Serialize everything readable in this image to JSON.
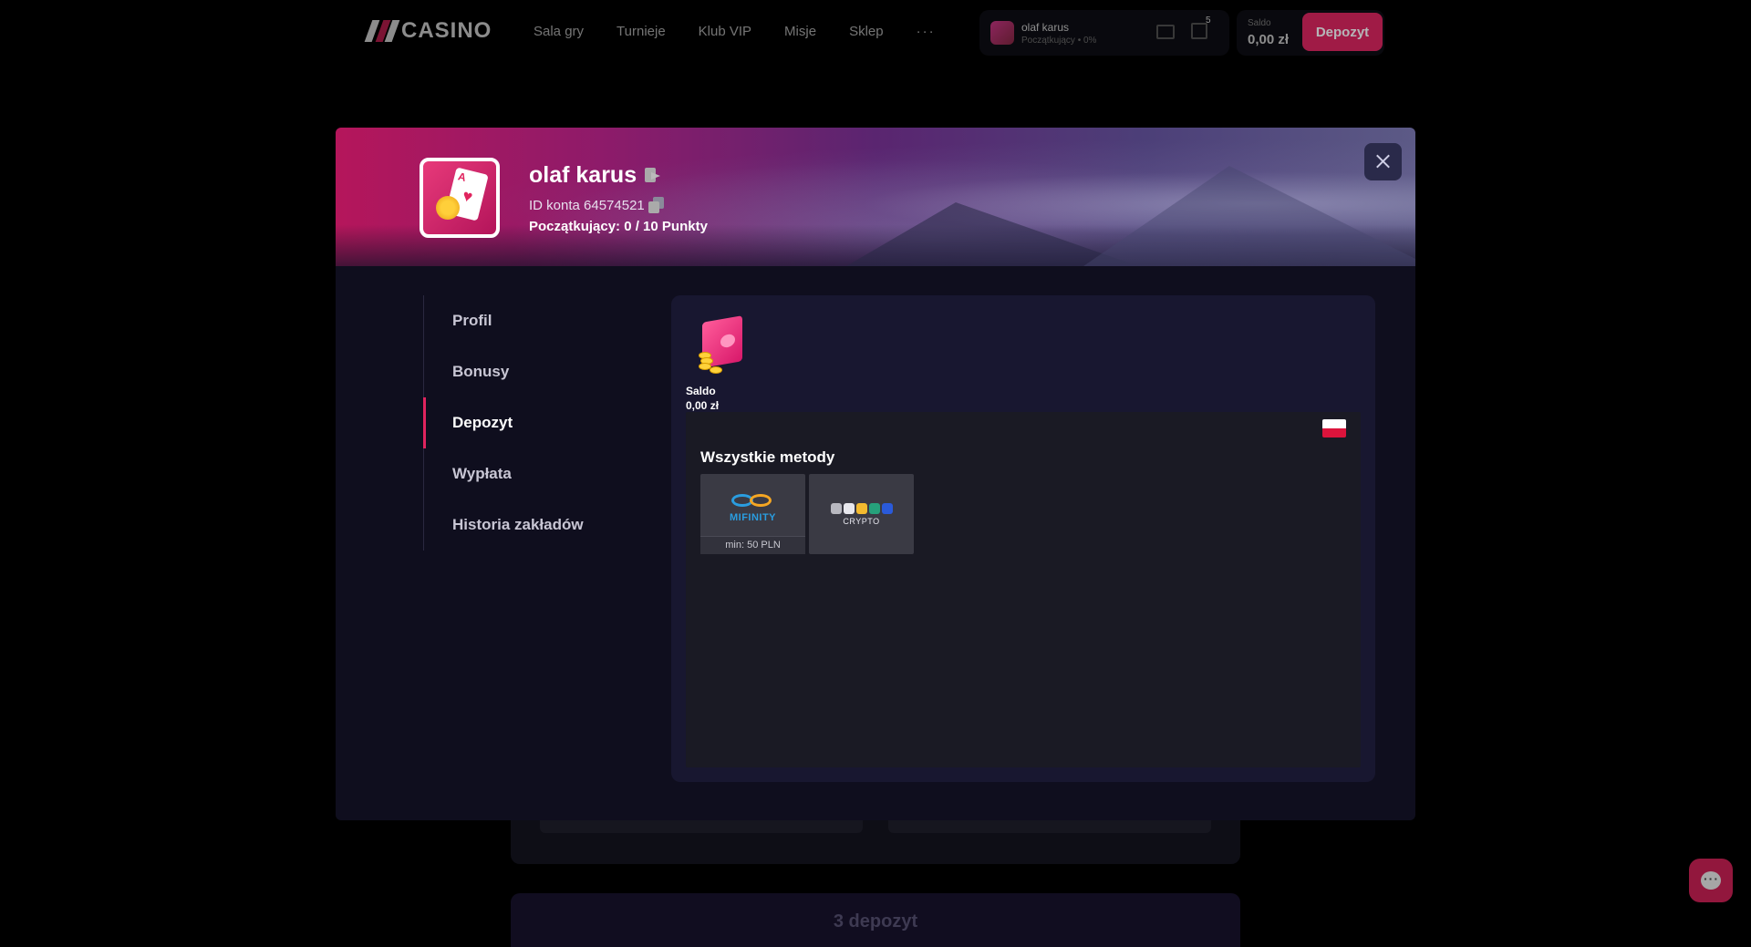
{
  "header": {
    "logo_text": "CASINO",
    "nav": [
      "Sala gry",
      "Turnieje",
      "Klub VIP",
      "Misje",
      "Sklep"
    ],
    "more": "···",
    "user_chip": {
      "name": "olaf karus",
      "level": "Początkujący • 0%",
      "gift_count": "5"
    },
    "balance": {
      "label": "Saldo",
      "value": "0,00 zł"
    },
    "deposit_button": "Depozyt"
  },
  "modal": {
    "username": "olaf karus",
    "account_id": "ID konta 64574521",
    "level_text": "Początkujący: 0  / 10 Punkty",
    "sidebar": [
      {
        "label": "Profil",
        "active": false
      },
      {
        "label": "Bonusy",
        "active": false
      },
      {
        "label": "Depozyt",
        "active": true
      },
      {
        "label": "Wypłata",
        "active": false
      },
      {
        "label": "Historia zakładów",
        "active": false
      }
    ],
    "saldo_label": "Saldo",
    "saldo_value": "0,00 zł",
    "methods_title": "Wszystkie metody",
    "methods": [
      {
        "name": "MIFINITY",
        "min": "min: 50 PLN"
      },
      {
        "name": "CRYPTO"
      }
    ]
  },
  "background": {
    "section_title": "3 depozyt"
  },
  "colors": {
    "accent": "#e0245e",
    "modal_bg": "#0f0e1e",
    "panel_bg": "#181730",
    "box_bg": "#1a1a24"
  }
}
